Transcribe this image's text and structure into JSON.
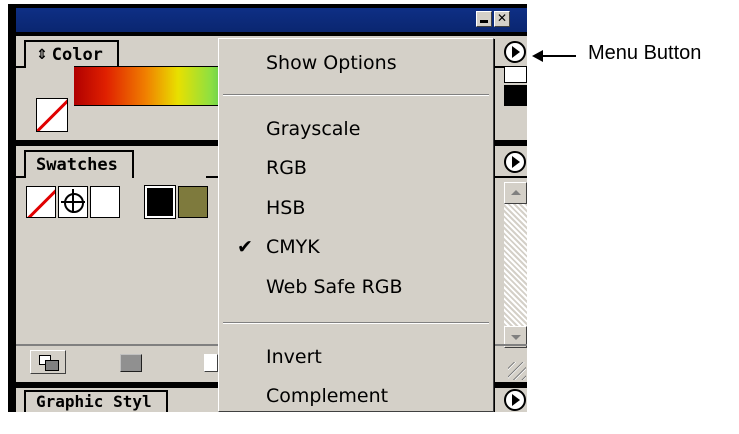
{
  "window": {
    "minimize_glyph": "",
    "close_glyph": "✕"
  },
  "color_panel": {
    "tab_icon": "⇕",
    "tab_label": "Color"
  },
  "swatches_panel": {
    "tab_label": "Swatches",
    "swatches": [
      "none",
      "registration",
      "white",
      "black",
      "olive"
    ],
    "olive_color": "#7e7a3d"
  },
  "graphic_styles_panel": {
    "tab_label": "Graphic Styl"
  },
  "menu": {
    "show_options": "Show Options",
    "modes": [
      "Grayscale",
      "RGB",
      "HSB",
      "CMYK",
      "Web Safe RGB"
    ],
    "checked_mode": "CMYK",
    "check_glyph": "✔",
    "invert": "Invert",
    "complement": "Complement"
  },
  "annotation": {
    "label": "Menu Button"
  },
  "colors": {
    "title_bar": "#0e2f85",
    "panel_bg": "#d4d0c8",
    "none_slash": "#e00000"
  }
}
